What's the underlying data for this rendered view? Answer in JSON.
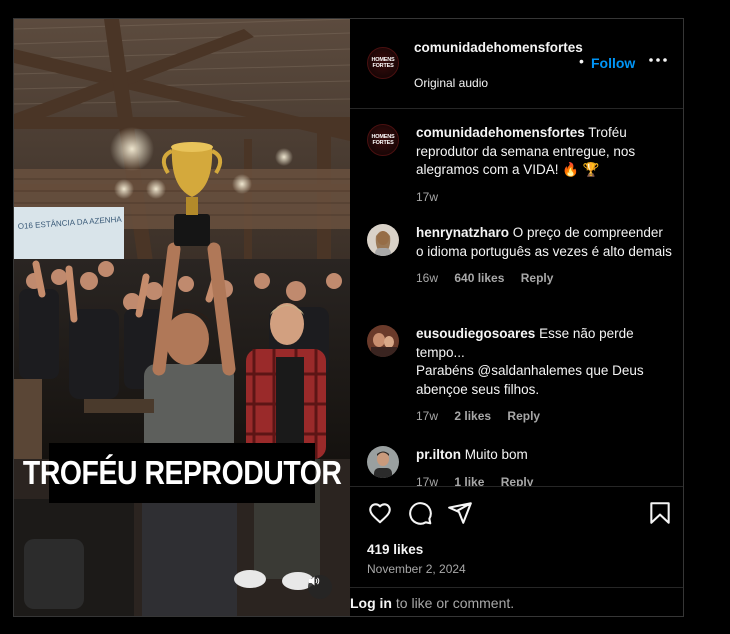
{
  "post": {
    "media_caption": "TROFÉU REPRODUTOR",
    "banner_text": "O16 ESTÂNCIA DA AZENHA"
  },
  "header": {
    "avatar_text": [
      "HOMENS",
      "FORTES"
    ],
    "username": "comunidadehomensfortes",
    "subtitle": "Original audio",
    "dot": "•",
    "follow_label": "Follow"
  },
  "comments": [
    {
      "username": "comunidadehomensfortes",
      "text": "Troféu reprodutor da semana entregue, nos alegramos com a VIDA! 🔥 🏆",
      "time": "17w"
    },
    {
      "username": "henrynatzharo",
      "text": "O preço de compreender o idioma português as vezes é alto demais",
      "time": "16w",
      "likes": "640 likes",
      "reply": "Reply"
    },
    {
      "username": "eusoudiegosoares",
      "text": "Esse não perde tempo...",
      "text2": "Parabéns @saldanhalemes que Deus abençoe seus filhos.",
      "time": "17w",
      "likes": "2 likes",
      "reply": "Reply"
    },
    {
      "username": "pr.ilton",
      "text": "Muito bom",
      "time": "17w",
      "likes": "1 like",
      "reply": "Reply"
    }
  ],
  "footer": {
    "likes": "419 likes",
    "date": "November 2, 2024",
    "login_label": "Log in",
    "login_suffix": " to like or comment."
  },
  "colors": {
    "background": "#000000",
    "text": "#f5f5f5",
    "secondary_text": "#a8a8a8",
    "follow_accent": "#0095f6",
    "divider": "#262626"
  }
}
